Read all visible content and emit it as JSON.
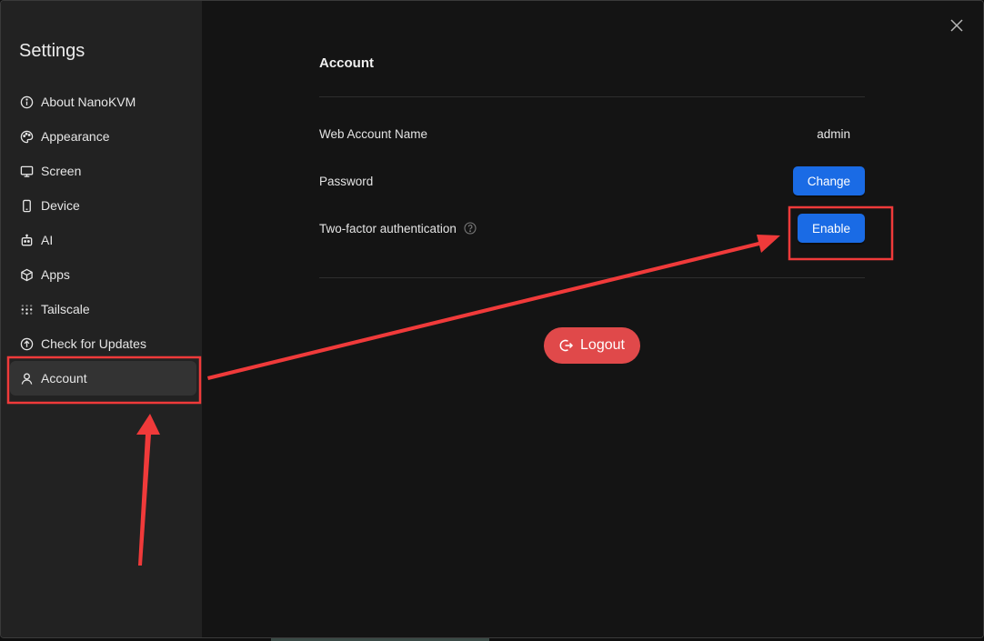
{
  "sidebar": {
    "title": "Settings",
    "items": [
      {
        "label": "About NanoKVM",
        "icon": "info-icon"
      },
      {
        "label": "Appearance",
        "icon": "palette-icon"
      },
      {
        "label": "Screen",
        "icon": "monitor-icon"
      },
      {
        "label": "Device",
        "icon": "phone-icon"
      },
      {
        "label": "AI",
        "icon": "robot-icon"
      },
      {
        "label": "Apps",
        "icon": "cube-icon"
      },
      {
        "label": "Tailscale",
        "icon": "dots-grid-icon"
      },
      {
        "label": "Check for Updates",
        "icon": "arrow-up-circle-icon"
      },
      {
        "label": "Account",
        "icon": "user-icon",
        "active": true
      }
    ]
  },
  "account": {
    "title": "Account",
    "web_account_name_label": "Web Account Name",
    "web_account_name_value": "admin",
    "password_label": "Password",
    "password_button": "Change",
    "twofa_label": "Two-factor authentication",
    "twofa_button": "Enable",
    "logout_button": "Logout"
  },
  "colors": {
    "accent": "#1a6be5",
    "danger": "#e0494a",
    "annotation": "#f03a3a",
    "sidebar_bg": "#222222",
    "main_bg": "#141414"
  }
}
